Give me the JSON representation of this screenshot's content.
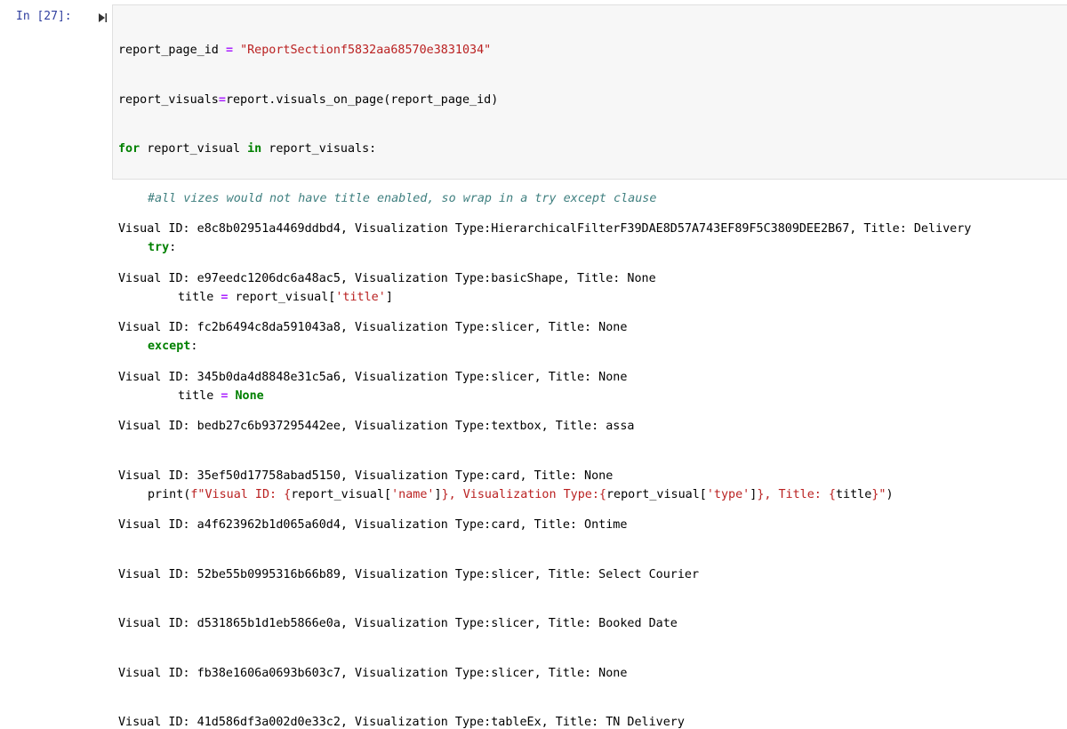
{
  "cell": {
    "prompt": "In [27]:",
    "code": {
      "l1_a": "report_page_id ",
      "l1_op": "=",
      "l1_b": " ",
      "l1_str": "\"ReportSectionf5832aa68570e3831034\"",
      "l2_a": "report_visuals",
      "l2_op": "=",
      "l2_b": "report.visuals_on_page(report_page_id)",
      "l3_kw1": "for",
      "l3_a": " report_visual ",
      "l3_kw2": "in",
      "l3_b": " report_visuals:",
      "l4_cm": "#all vizes would not have title enabled, so wrap in a try except clause",
      "l5_kw": "try",
      "l5_a": ":",
      "l6_a": "title ",
      "l6_op": "=",
      "l6_b": " report_visual[",
      "l6_str": "'title'",
      "l6_c": "]",
      "l7_kw": "except",
      "l7_a": ":",
      "l8_a": "title ",
      "l8_op": "=",
      "l8_b": " ",
      "l8_kw": "None",
      "l10_a": "print(",
      "l10_s1": "f\"Visual ID: {",
      "l10_b": "report_visual[",
      "l10_s2": "'name'",
      "l10_c": "]",
      "l10_s3": "}, Visualization Type:{",
      "l10_d": "report_visual[",
      "l10_s4": "'type'",
      "l10_e": "]",
      "l10_s5": "}, Title: {",
      "l10_f": "title",
      "l10_s6": "}\"",
      "l10_g": ")"
    }
  },
  "output_lines": [
    "Visual ID: e8c8b02951a4469ddbd4, Visualization Type:HierarchicalFilterF39DAE8D57A743EF89F5C3809DEE2B67, Title: Delivery",
    "Visual ID: e97eedc1206dc6a48ac5, Visualization Type:basicShape, Title: None",
    "Visual ID: fc2b6494c8da591043a8, Visualization Type:slicer, Title: None",
    "Visual ID: 345b0da4d8848e31c5a6, Visualization Type:slicer, Title: None",
    "Visual ID: bedb27c6b937295442ee, Visualization Type:textbox, Title: assa",
    "Visual ID: 35ef50d17758abad5150, Visualization Type:card, Title: None",
    "Visual ID: a4f623962b1d065a60d4, Visualization Type:card, Title: Ontime",
    "Visual ID: 52be55b0995316b66b89, Visualization Type:slicer, Title: Select Courier",
    "Visual ID: d531865b1d1eb5866e0a, Visualization Type:slicer, Title: Booked Date",
    "Visual ID: fb38e1606a0693b603c7, Visualization Type:slicer, Title: None",
    "Visual ID: 41d586df3a002d0e33c2, Visualization Type:tableEx, Title: TN Delivery"
  ]
}
